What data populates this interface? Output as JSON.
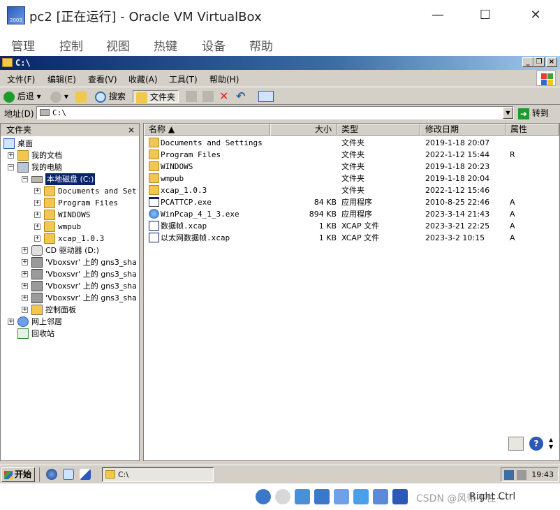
{
  "host": {
    "title": "pc2 [正在运行] - Oracle VM VirtualBox",
    "icon_text": "2003",
    "menu": [
      "管理",
      "控制",
      "视图",
      "热键",
      "设备",
      "帮助"
    ],
    "controls": [
      "minimize",
      "maximize",
      "close"
    ],
    "host_key": "Right Ctrl",
    "watermark": "CSDN @风带不住~"
  },
  "explorer": {
    "title": "C:\\",
    "menu": [
      "文件(F)",
      "编辑(E)",
      "查看(V)",
      "收藏(A)",
      "工具(T)",
      "帮助(H)"
    ],
    "toolbar": {
      "back": "后退",
      "search": "搜索",
      "folders": "文件夹"
    },
    "address": {
      "label": "地址(D)",
      "value": "C:\\",
      "go": "转到"
    },
    "tree": {
      "header": "文件夹",
      "close": "×",
      "items": [
        {
          "label": "桌面",
          "expander": "",
          "icon": "desktop-icon"
        },
        {
          "label": "我的文档",
          "expander": "+",
          "icon": "documents-icon"
        },
        {
          "label": "我的电脑",
          "expander": "−",
          "icon": "computer-icon"
        },
        {
          "label": "本地磁盘 (C:)",
          "expander": "−",
          "icon": "drive-icon"
        },
        {
          "label": "Documents and Settings",
          "expander": "+",
          "icon": "folder-icon"
        },
        {
          "label": "Program Files",
          "expander": "+",
          "icon": "folder-icon"
        },
        {
          "label": "WINDOWS",
          "expander": "+",
          "icon": "folder-icon"
        },
        {
          "label": "wmpub",
          "expander": "+",
          "icon": "folder-icon"
        },
        {
          "label": "xcap_1.0.3",
          "expander": "+",
          "icon": "folder-icon"
        },
        {
          "label": "CD 驱动器 (D:)",
          "expander": "+",
          "icon": "cd-drive-icon"
        },
        {
          "label": "'Vboxsvr' 上的 gns3_sha",
          "expander": "+",
          "icon": "network-drive-icon"
        },
        {
          "label": "'Vboxsvr' 上的 gns3_sha",
          "expander": "+",
          "icon": "network-drive-icon"
        },
        {
          "label": "'Vboxsvr' 上的 gns3_sha",
          "expander": "+",
          "icon": "network-drive-icon"
        },
        {
          "label": "'Vboxsvr' 上的 gns3_sha",
          "expander": "+",
          "icon": "network-drive-icon"
        },
        {
          "label": "控制面板",
          "expander": "+",
          "icon": "control-panel-icon"
        },
        {
          "label": "网上邻居",
          "expander": "+",
          "icon": "network-icon"
        },
        {
          "label": "回收站",
          "expander": "",
          "icon": "recycle-bin-icon"
        }
      ]
    },
    "list": {
      "columns": [
        "名称",
        "大小",
        "类型",
        "修改日期",
        "属性"
      ],
      "rows": [
        {
          "name": "Documents and Settings",
          "size": "",
          "type": "文件夹",
          "date": "2019-1-18 20:07",
          "attr": "",
          "icon": "folder-icon"
        },
        {
          "name": "Program Files",
          "size": "",
          "type": "文件夹",
          "date": "2022-1-12 15:44",
          "attr": "R",
          "icon": "folder-icon"
        },
        {
          "name": "WINDOWS",
          "size": "",
          "type": "文件夹",
          "date": "2019-1-18 20:23",
          "attr": "",
          "icon": "folder-icon"
        },
        {
          "name": "wmpub",
          "size": "",
          "type": "文件夹",
          "date": "2019-1-18 20:04",
          "attr": "",
          "icon": "folder-icon"
        },
        {
          "name": "xcap_1.0.3",
          "size": "",
          "type": "文件夹",
          "date": "2022-1-12 15:46",
          "attr": "",
          "icon": "folder-icon"
        },
        {
          "name": "PCATTCP.exe",
          "size": "84 KB",
          "type": "应用程序",
          "date": "2010-8-25 22:46",
          "attr": "A",
          "icon": "exe-icon"
        },
        {
          "name": "WinPcap_4_1_3.exe",
          "size": "894 KB",
          "type": "应用程序",
          "date": "2023-3-14 21:43",
          "attr": "A",
          "icon": "installer-icon"
        },
        {
          "name": "数据帧.xcap",
          "size": "1 KB",
          "type": "XCAP 文件",
          "date": "2023-3-21 22:25",
          "attr": "A",
          "icon": "xcap-file-icon"
        },
        {
          "name": "以太网数据帧.xcap",
          "size": "1 KB",
          "type": "XCAP 文件",
          "date": "2023-3-2 10:15",
          "attr": "A",
          "icon": "xcap-file-icon"
        }
      ]
    }
  },
  "taskbar": {
    "start": "开始",
    "task": "C:\\",
    "clock": "19:43"
  },
  "colors": {
    "title_active": "#0a246a",
    "chrome": "#d4d0c8",
    "selection": "#0a246a"
  }
}
